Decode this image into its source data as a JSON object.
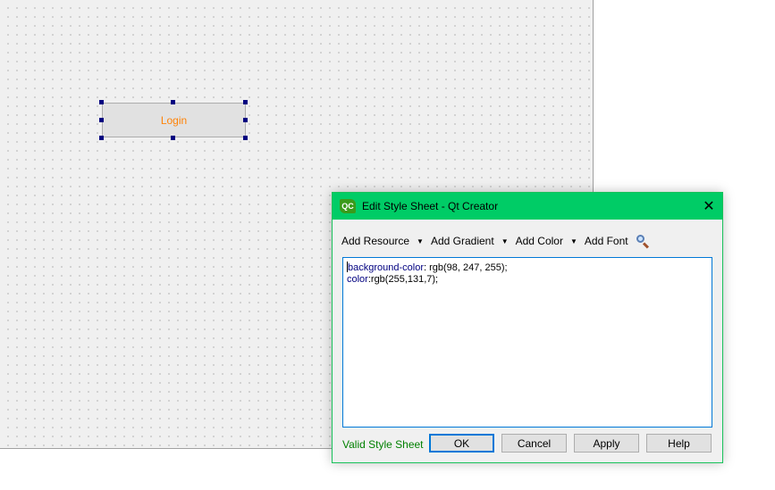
{
  "form": {
    "login_button": {
      "label": "Login",
      "text_color": "#ff8307"
    }
  },
  "dialog": {
    "title": "Edit Style Sheet - Qt Creator",
    "logo_text": "QC",
    "close_glyph": "✕",
    "toolbar": {
      "add_resource": "Add Resource",
      "add_gradient": "Add Gradient",
      "add_color": "Add Color",
      "add_font": "Add Font",
      "dropdown_glyph": "▼"
    },
    "editor": {
      "line1_prop": "background-color",
      "line1_value": ": rgb(98, 247, 255);",
      "line2_prop": "color",
      "line2_value": ":rgb(255,131,7);"
    },
    "status": "Valid Style Sheet",
    "buttons": {
      "ok": "OK",
      "cancel": "Cancel",
      "apply": "Apply",
      "help": "Help"
    }
  },
  "colors": {
    "titlebar": "#00cc66",
    "status_valid": "#008000",
    "property_keyword": "#000080",
    "selection_handle": "#000080"
  }
}
